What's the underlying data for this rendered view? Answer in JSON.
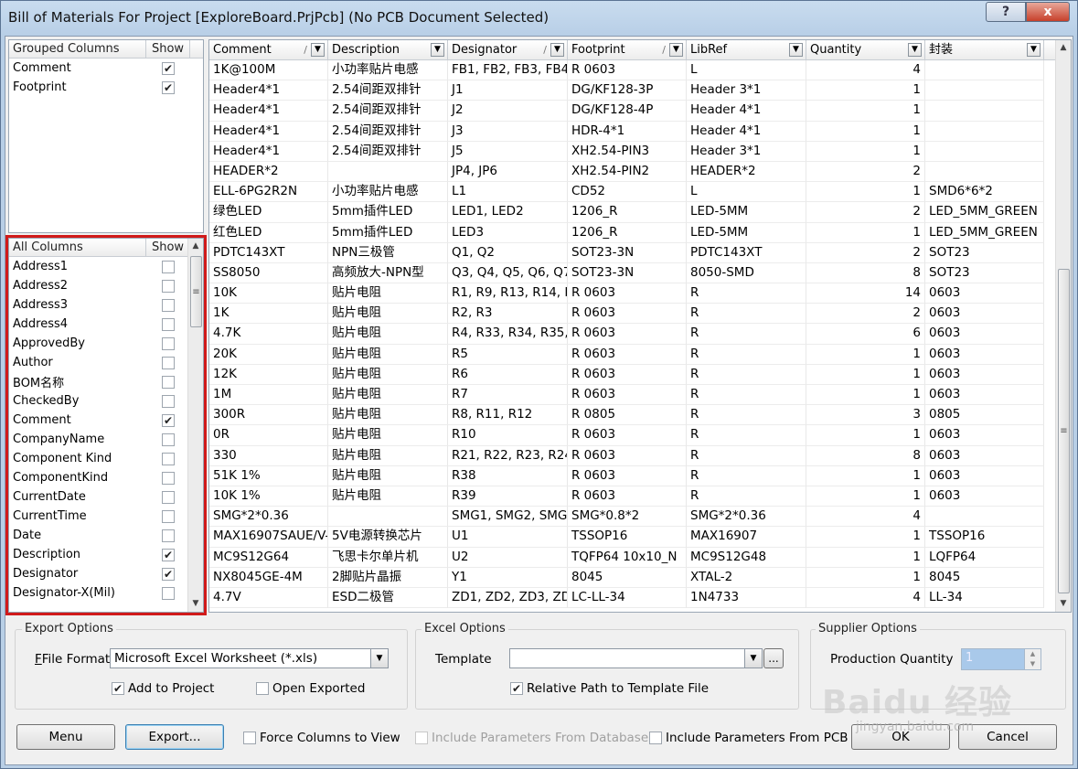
{
  "window": {
    "title": "Bill of Materials For Project [ExploreBoard.PrjPcb] (No PCB Document Selected)",
    "help": "?",
    "close": "x"
  },
  "grouped": {
    "header_col": "Grouped Columns",
    "header_show": "Show",
    "items": [
      {
        "label": "Comment",
        "checked": true
      },
      {
        "label": "Footprint",
        "checked": true
      }
    ]
  },
  "allcols": {
    "header_col": "All Columns",
    "header_show": "Show",
    "items": [
      {
        "label": "Address1",
        "checked": false
      },
      {
        "label": "Address2",
        "checked": false
      },
      {
        "label": "Address3",
        "checked": false
      },
      {
        "label": "Address4",
        "checked": false
      },
      {
        "label": "ApprovedBy",
        "checked": false
      },
      {
        "label": "Author",
        "checked": false
      },
      {
        "label": "BOM名称",
        "checked": false
      },
      {
        "label": "CheckedBy",
        "checked": false
      },
      {
        "label": "Comment",
        "checked": true
      },
      {
        "label": "CompanyName",
        "checked": false
      },
      {
        "label": "Component Kind",
        "checked": false
      },
      {
        "label": "ComponentKind",
        "checked": false
      },
      {
        "label": "CurrentDate",
        "checked": false
      },
      {
        "label": "CurrentTime",
        "checked": false
      },
      {
        "label": "Date",
        "checked": false
      },
      {
        "label": "Description",
        "checked": true
      },
      {
        "label": "Designator",
        "checked": true
      },
      {
        "label": "Designator-X(Mil)",
        "checked": false
      }
    ]
  },
  "grid": {
    "columns": [
      "Comment",
      "Description",
      "Designator",
      "Footprint",
      "LibRef",
      "Quantity",
      "封装"
    ],
    "rows": [
      [
        "1K@100M",
        "小功率贴片电感",
        "FB1, FB2, FB3, FB4",
        "R 0603",
        "L",
        "4",
        ""
      ],
      [
        "Header4*1",
        "2.54间距双排针",
        "J1",
        "DG/KF128-3P",
        "Header 3*1",
        "1",
        ""
      ],
      [
        "Header4*1",
        "2.54间距双排针",
        "J2",
        "DG/KF128-4P",
        "Header 4*1",
        "1",
        ""
      ],
      [
        "Header4*1",
        "2.54间距双排针",
        "J3",
        "HDR-4*1",
        "Header 4*1",
        "1",
        ""
      ],
      [
        "Header4*1",
        "2.54间距双排针",
        "J5",
        "XH2.54-PIN3",
        "Header 3*1",
        "1",
        ""
      ],
      [
        "HEADER*2",
        "",
        "JP4, JP6",
        "XH2.54-PIN2",
        "HEADER*2",
        "2",
        ""
      ],
      [
        "ELL-6PG2R2N",
        "小功率贴片电感",
        "L1",
        "CD52",
        "L",
        "1",
        "SMD6*6*2"
      ],
      [
        "绿色LED",
        "5mm插件LED",
        "LED1, LED2",
        "1206_R",
        "LED-5MM",
        "2",
        "LED_5MM_GREEN"
      ],
      [
        "红色LED",
        "5mm插件LED",
        "LED3",
        "1206_R",
        "LED-5MM",
        "1",
        "LED_5MM_GREEN"
      ],
      [
        "PDTC143XT",
        "NPN三极管",
        "Q1, Q2",
        "SOT23-3N",
        "PDTC143XT",
        "2",
        "SOT23"
      ],
      [
        "SS8050",
        "高频放大-NPN型",
        "Q3, Q4, Q5, Q6, Q7,",
        "SOT23-3N",
        "8050-SMD",
        "8",
        "SOT23"
      ],
      [
        "10K",
        "贴片电阻",
        "R1, R9, R13, R14, R",
        "R 0603",
        "R",
        "14",
        "0603"
      ],
      [
        "1K",
        "贴片电阻",
        "R2, R3",
        "R 0603",
        "R",
        "2",
        "0603"
      ],
      [
        "4.7K",
        "贴片电阻",
        "R4, R33, R34, R35,",
        "R 0603",
        "R",
        "6",
        "0603"
      ],
      [
        "20K",
        "贴片电阻",
        "R5",
        "R 0603",
        "R",
        "1",
        "0603"
      ],
      [
        "12K",
        "贴片电阻",
        "R6",
        "R 0603",
        "R",
        "1",
        "0603"
      ],
      [
        "1M",
        "贴片电阻",
        "R7",
        "R 0603",
        "R",
        "1",
        "0603"
      ],
      [
        "300R",
        "贴片电阻",
        "R8, R11, R12",
        "R 0805",
        "R",
        "3",
        "0805"
      ],
      [
        "0R",
        "贴片电阻",
        "R10",
        "R 0603",
        "R",
        "1",
        "0603"
      ],
      [
        "330",
        "贴片电阻",
        "R21, R22, R23, R24",
        "R 0603",
        "R",
        "8",
        "0603"
      ],
      [
        "51K 1%",
        "贴片电阻",
        "R38",
        "R 0603",
        "R",
        "1",
        "0603"
      ],
      [
        "10K 1%",
        "贴片电阻",
        "R39",
        "R 0603",
        "R",
        "1",
        "0603"
      ],
      [
        "SMG*2*0.36",
        "",
        "SMG1, SMG2, SMG",
        "SMG*0.8*2",
        "SMG*2*0.36",
        "4",
        ""
      ],
      [
        "MAX16907SAUE/V-",
        "5V电源转换芯片",
        "U1",
        "TSSOP16",
        "MAX16907",
        "1",
        "TSSOP16"
      ],
      [
        "MC9S12G64",
        "飞思卡尔单片机",
        "U2",
        "TQFP64 10x10_N",
        "MC9S12G48",
        "1",
        "LQFP64"
      ],
      [
        "NX8045GE-4M",
        "2脚贴片晶振",
        "Y1",
        "8045",
        "XTAL-2",
        "1",
        "8045"
      ],
      [
        "4.7V",
        "ESD二极管",
        "ZD1, ZD2, ZD3, ZD",
        "LC-LL-34",
        "1N4733",
        "4",
        "LL-34"
      ]
    ]
  },
  "export_options": {
    "title": "Export Options",
    "file_format_label": "File Format",
    "file_format_value": "Microsoft Excel Worksheet (*.xls)",
    "add_to_project": "Add to Project",
    "open_exported": "Open Exported"
  },
  "excel_options": {
    "title": "Excel Options",
    "template_label": "Template",
    "template_value": "",
    "browse": "...",
    "relative_path": "Relative Path to Template File"
  },
  "supplier_options": {
    "title": "Supplier Options",
    "production_quantity_label": "Production Quantity",
    "production_quantity_value": "1"
  },
  "footer": {
    "menu": "Menu",
    "export": "Export...",
    "force_columns": "Force Columns to View",
    "include_db": "Include Parameters From Database",
    "include_pcb": "Include Parameters From PCB",
    "ok": "OK",
    "cancel": "Cancel"
  },
  "watermark": {
    "logo": "Baidu 经验",
    "url": "jingyan.baidu.com"
  }
}
